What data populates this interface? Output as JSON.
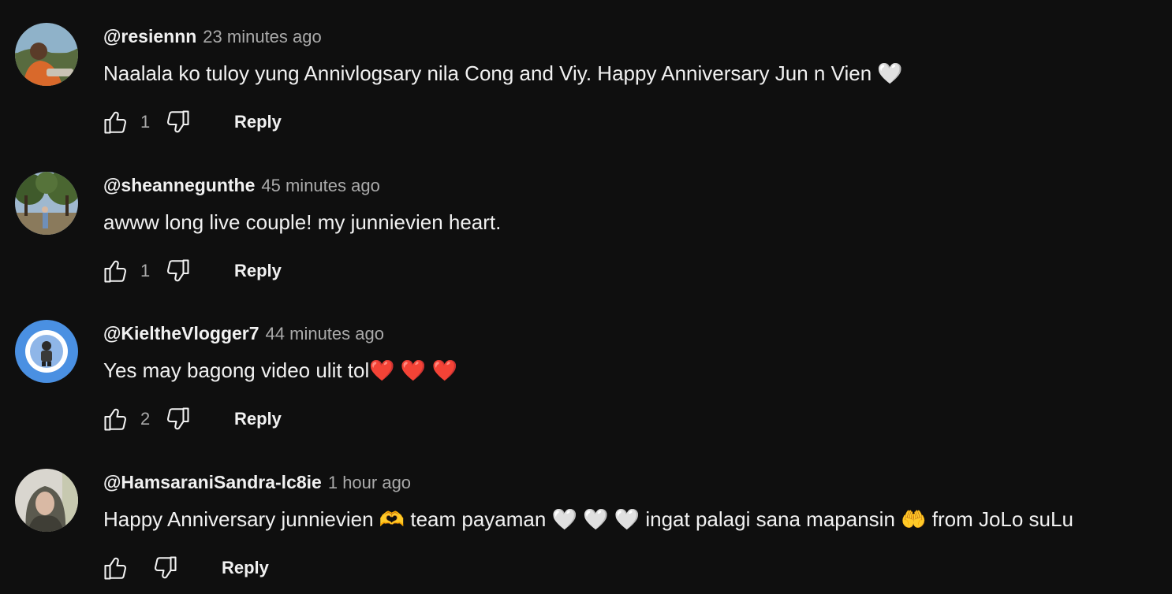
{
  "comments": [
    {
      "author": "@resiennn",
      "time": "23 minutes ago",
      "text": "Naalala ko tuloy yung Annivlogsary nila Cong and Viy. Happy Anniversary Jun n Vien",
      "emoji_tail": " 🤍",
      "like_count": "1",
      "reply_label": "Reply",
      "avatar_icon": "photo-avatar-orange-jacket"
    },
    {
      "author": "@sheannegunthe",
      "time": "45 minutes ago",
      "text": "awww long live couple! my junnievien heart.",
      "emoji_tail": "",
      "like_count": "1",
      "reply_label": "Reply",
      "avatar_icon": "photo-avatar-trees"
    },
    {
      "author": "@KieltheVlogger7",
      "time": "44 minutes ago",
      "text": "Yes may bagong video ulit tol",
      "emoji_tail": "❤️ ❤️ ❤️",
      "like_count": "2",
      "reply_label": "Reply",
      "avatar_icon": "cartoon-avatar-blue-ring"
    },
    {
      "author": "@HamsaraniSandra-lc8ie",
      "time": "1 hour ago",
      "text": "Happy Anniversary junnievien 🫶 team payaman 🤍 🤍 🤍 ingat palagi sana mapansin 🤲 from JoLo suLu",
      "emoji_tail": "",
      "like_count": "",
      "reply_label": "Reply",
      "avatar_icon": "photo-avatar-hijab"
    }
  ],
  "colors": {
    "background": "#0f0f0f",
    "primary_text": "#f1f1f1",
    "secondary_text": "#aaaaaa",
    "heart_red": "#e0262e",
    "heart_white": "#f2f2f2"
  }
}
